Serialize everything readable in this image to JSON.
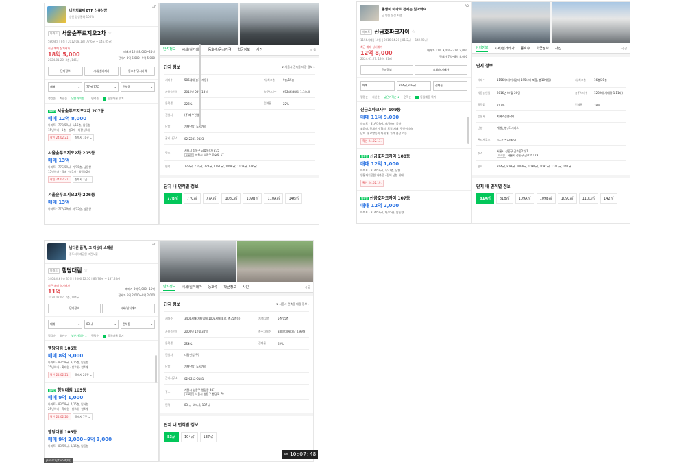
{
  "colors": {
    "accent": "#03c75a",
    "sale": "#2b73e2",
    "price_red": "#e0474e"
  },
  "panels": [
    {
      "ad": {
        "line1": "비만치료제 ETF 신규상장",
        "line2": "승인 임상통화 100%",
        "tag": "AD"
      },
      "chip": "아파트",
      "name": "서울숲푸르지오2차",
      "info": "586세대 | 8동 | 2012.08.18 | 77.6㎡ ~ 146.05㎡",
      "price": {
        "caption": "최근 매매 실거래가",
        "main": "18억 5,000",
        "date": "2024.01.20. 3층, 146㎡",
        "r1": "매매가 12억 8,000~24억",
        "r2": "전세가 8억 5,000~9억 5,000"
      },
      "buttons": [
        "단지정보",
        "시세/실거래가",
        "동호수/공시가격"
      ],
      "filters": [
        "매매",
        "77㎡,77C",
        "전체동"
      ],
      "sort": [
        "랭킹순",
        "최신순",
        "낮은가격순 ↓",
        "면적순"
      ],
      "sort_cb": "동일매물 묶기",
      "listings": [
        {
          "title": "서울숲푸르지오2차 207동",
          "price": "매매 12억 8,000",
          "d1": "아파트 · 77B/59㎡, 1/15층, 남동향",
          "d2": "15년이내 · 1층 · 방3개 · 화장실2개",
          "confirm": "확인 24.02.21.",
          "agent": "중개사 10곳 ⌄"
        },
        {
          "title": "서울숲푸르지오2차 205동",
          "price": "매매 13억",
          "d1": "아파트 · 77C/59㎡, 가/15층, 남동향",
          "d2": "15년이내 · 급매 · 방3개 · 화장실2개",
          "confirm": "확인 24.02.21.",
          "agent": "중개사 2곳 ⌄"
        },
        {
          "title": "서울숲푸르지오2차 206동",
          "price": "매매 13억",
          "d1": "아파트 · 77A/59㎡, 저/15층, 남동향",
          "d2": "",
          "confirm": "",
          "agent": ""
        }
      ],
      "tabs": [
        "단지정보",
        "시세/실거래가",
        "동호수/공시가격",
        "학군정보",
        "사진"
      ],
      "share": "◁ 공",
      "section_title": "단지 정보",
      "section_link": "❦ 서울시 건축물 대장 정보 ›",
      "rows": [
        {
          "k": "세대수",
          "v": "586세대(총11개동)",
          "k2": "저/최고층",
          "v2": "9층/15층"
        },
        {
          "k": "사용승인일",
          "v": "2012년 08월 18일",
          "k2": "총주차대수",
          "v2": "672대(세대당 1.14대)"
        },
        {
          "k": "용적률",
          "v": "226%",
          "k2": "건폐율",
          "v2": "22%"
        },
        {
          "k": "건설사",
          "v": "(주)대우건설"
        },
        {
          "k": "난방",
          "v": "개별난방, 도시가스"
        },
        {
          "k": "관리사무소",
          "v": "02-2281-9323"
        },
        {
          "k": "주소",
          "v": "서울시 성동구 금호동4가 235",
          "addrchip": "도로명",
          "v_b": "서울시 성동구 금호로 17"
        },
        {
          "k": "면적",
          "v": "77B㎡, 77C㎡, 77A㎡, 108C㎡, 109B㎡, 110A㎡, 146㎡"
        }
      ],
      "area_title": "단지 내 면적별 정보",
      "areas": [
        "77B㎡",
        "77C㎡",
        "77A㎡",
        "108C㎡",
        "109B㎡",
        "110A㎡",
        "146㎡"
      ]
    },
    {
      "ad": {
        "line1": "동생이 아파트 전세는 알아봐요.",
        "line2": "님 병원 동생 저렴",
        "tag": "AD"
      },
      "chip": "아파트",
      "name": "신금호파크자이",
      "info": "1156세대 | 10동 | 2016.04.20 | 81.2㎡ ~ 142.92㎡",
      "price": {
        "caption": "최근 매매 실거래가",
        "main": "12억 8,000",
        "date": "2024.01.27. 13층, 81㎡",
        "r1": "매매가 11억 9,000~21억 5,000",
        "r2": "전세가 7억~8억 8,000"
      },
      "buttons": [
        "단지정보",
        "시세/실거래가"
      ],
      "filters": [
        "매매",
        "81A㎡,81B㎡",
        "전체동"
      ],
      "sort": [
        "랭킹순",
        "최신순",
        "낮은가격순 ↓",
        "면적순"
      ],
      "sort_cb": "동일매물 묶기",
      "listings": [
        {
          "title": "신금호파크자이 109동",
          "price": "매매 11억 9,000",
          "d1": "아파트 · 81A/59㎡, 저/20층, 동향",
          "d2": "초급매, 전세만기 협의, 로얄 세대, 주인이 4층",
          "d3": "단지 내 로얄동의 다세대, 가격 협상 가능",
          "confirm": "확인 24.02.13.",
          "agent": ""
        },
        {
          "title": "신금호파크자이 108동",
          "price": "매매 12억 1,000",
          "d1": "아파트 · 81A/59㎡, 1/21층, 남향",
          "d2": "영통까지공원 가까운 · 전체 남향 세대",
          "confirm": "확인 24.02.19.",
          "agent": "",
          "newbadge": "집주인"
        },
        {
          "title": "신금호파크자이 107동",
          "price": "매매 12억 2,000",
          "d1": "아파트 · 81A/59㎡, 저/15층, 남동향",
          "d2": "",
          "confirm": "",
          "agent": "",
          "newbadge": "집주인"
        }
      ],
      "tabs": [
        "단지정보",
        "시세/실거래가",
        "동호수",
        "학군정보",
        "사진"
      ],
      "share": "◁ 공",
      "section_title": "단지 정보",
      "section_link": "",
      "rows": [
        {
          "k": "세대수",
          "v": "1156세대(기타임대 195세대 포함, 총10개동)",
          "k2": "저/최고층",
          "v2": "16층/21층"
        },
        {
          "k": "사용승인일",
          "v": "2016년 04월 20일",
          "k2": "총주차대수",
          "v2": "1289대(세대당 1.11대)"
        },
        {
          "k": "용적률",
          "v": "217%",
          "k2": "건폐율",
          "v2": "18%"
        },
        {
          "k": "건설사",
          "v": "지에스건설(주)"
        },
        {
          "k": "난방",
          "v": "개별난방, 도시가스"
        },
        {
          "k": "관리사무소",
          "v": "02-2252-8660"
        },
        {
          "k": "주소",
          "v": "서울시 성동구 금호동2가 1",
          "addrchip": "도로명",
          "v_b": "서울시 성동구 금호로 173"
        },
        {
          "k": "면적",
          "v": "81A㎡, 81B㎡, 109A㎡, 109B㎡, 109C㎡, 110D㎡, 142㎡"
        }
      ],
      "area_title": "단지 내 면적별 정보",
      "areas": [
        "81A㎡",
        "81B㎡",
        "109A㎡",
        "109B㎡",
        "109C㎡",
        "110D㎡",
        "142㎡"
      ]
    },
    {
      "ad": {
        "line1": "남다른 품격, 그 이상의 스페셜",
        "line2": "중도자이래공원 그린노블",
        "tag": "AD"
      },
      "chip": "아파트",
      "name": "행당대림",
      "info": "3404세대 | 총 35동 | 2000.12.30 | 83.76㎡ ~ 137.26㎡",
      "price": {
        "caption": "최근 매매 실거래가",
        "main": "11억",
        "date": "2024.02.07. 7층, 104㎡",
        "r1": "매매가 8억 9,000~15억",
        "r2": "전세가 5억 2,000~8억 2,000"
      },
      "buttons": [
        "단지정보",
        "시세/실거래가"
      ],
      "filters": [
        "매매",
        "83㎡",
        "전체동"
      ],
      "sort": [
        "랭킹순",
        "최신순",
        "낮은가격순 ↓",
        "면적순"
      ],
      "sort_cb": "동일매물 묶기",
      "listings": [
        {
          "title": "행당대림 105동",
          "price": "매매 8억 9,000",
          "d1": "아파트 · 83/59㎡, 3/15층, 남동향",
          "d2": "25년이내 · 확태원 · 방2개 · 방4개",
          "confirm": "확인 24.02.21.",
          "agent": "중개사 20곳 ⌄"
        },
        {
          "title": "행당대림 105동",
          "price": "매매 9억 1,000",
          "d1": "아파트 · 83/59㎡, 4/15층, 남서향",
          "d2": "25년이내 · 확태원 · 방2개 · 방4개",
          "confirm": "확인 24.02.20.",
          "agent": "중개사 7곳 ⌄",
          "newbadge": "집주인"
        },
        {
          "title": "행당대림 105동",
          "price": "매매 9억 2,000~9억 3,000",
          "d1": "아파트 · 83/59㎡, 3/15층, 남동향",
          "d2": "",
          "confirm": "",
          "agent": ""
        }
      ],
      "tabs": [
        "단지정보",
        "시세/실거래가",
        "동호수",
        "학군정보",
        "사진"
      ],
      "share": "◁ 공",
      "section_title": "단지 정보",
      "section_link": "❦ 서울시 건축물 대장 정보 ›",
      "rows": [
        {
          "k": "세대수",
          "v": "3404세대(기타임대 1005세대 포함, 총35개동)",
          "k2": "저/최고층",
          "v2": "5층/15층"
        },
        {
          "k": "사용승인일",
          "v": "2000년 12월 30일",
          "k2": "총주차대수",
          "v2": "3384대(세대당 0.99대)"
        },
        {
          "k": "용적률",
          "v": "254%",
          "k2": "건폐율",
          "v2": "22%"
        },
        {
          "k": "건설사",
          "v": "대림산업(주)"
        },
        {
          "k": "난방",
          "v": "개별난방, 도시가스"
        },
        {
          "k": "관리사무소",
          "v": "02-6212-6181"
        },
        {
          "k": "주소",
          "v": "서울시 성동구 행당동 347",
          "addrchip": "도로명",
          "v_b": "서울시 성동구 행당로 79"
        },
        {
          "k": "면적",
          "v": "83㎡, 104㎡, 137㎡"
        }
      ],
      "area_title": "단지 내 면적별 정보",
      "areas": [
        "83㎡",
        "104㎡",
        "137㎡"
      ]
    }
  ],
  "clock": {
    "ampm": "PM",
    "time": "10:07:48"
  },
  "tooltip": "javascript:void(0);"
}
